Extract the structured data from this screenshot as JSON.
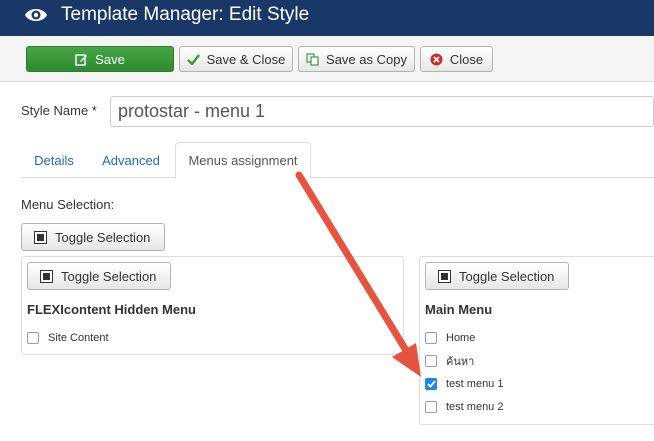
{
  "header": {
    "title": "Template Manager: Edit Style",
    "icon": "eye-icon",
    "background": "#1a3867"
  },
  "toolbar": {
    "save_label": "Save",
    "save_close_label": "Save & Close",
    "save_copy_label": "Save as Copy",
    "close_label": "Close",
    "accent": "#46a546"
  },
  "form": {
    "style_name_label": "Style Name *",
    "style_name_value": "protostar - menu 1"
  },
  "tabs": [
    {
      "label": "Details",
      "active": false
    },
    {
      "label": "Advanced",
      "active": false
    },
    {
      "label": "Menus assignment",
      "active": true
    }
  ],
  "menus": {
    "selection_label": "Menu Selection:",
    "toggle_label": "Toggle Selection",
    "groups": [
      {
        "title": "FLEXIcontent Hidden Menu",
        "toggle_label": "Toggle Selection",
        "items": [
          {
            "label": "Site Content",
            "checked": false
          }
        ]
      },
      {
        "title": "Main Menu",
        "toggle_label": "Toggle Selection",
        "items": [
          {
            "label": "Home",
            "checked": false
          },
          {
            "label": "ค้นหา",
            "checked": false
          },
          {
            "label": "test menu 1",
            "checked": true
          },
          {
            "label": "test menu 2",
            "checked": false
          }
        ]
      }
    ]
  },
  "annotation": {
    "arrow_color": "#e8533f"
  }
}
